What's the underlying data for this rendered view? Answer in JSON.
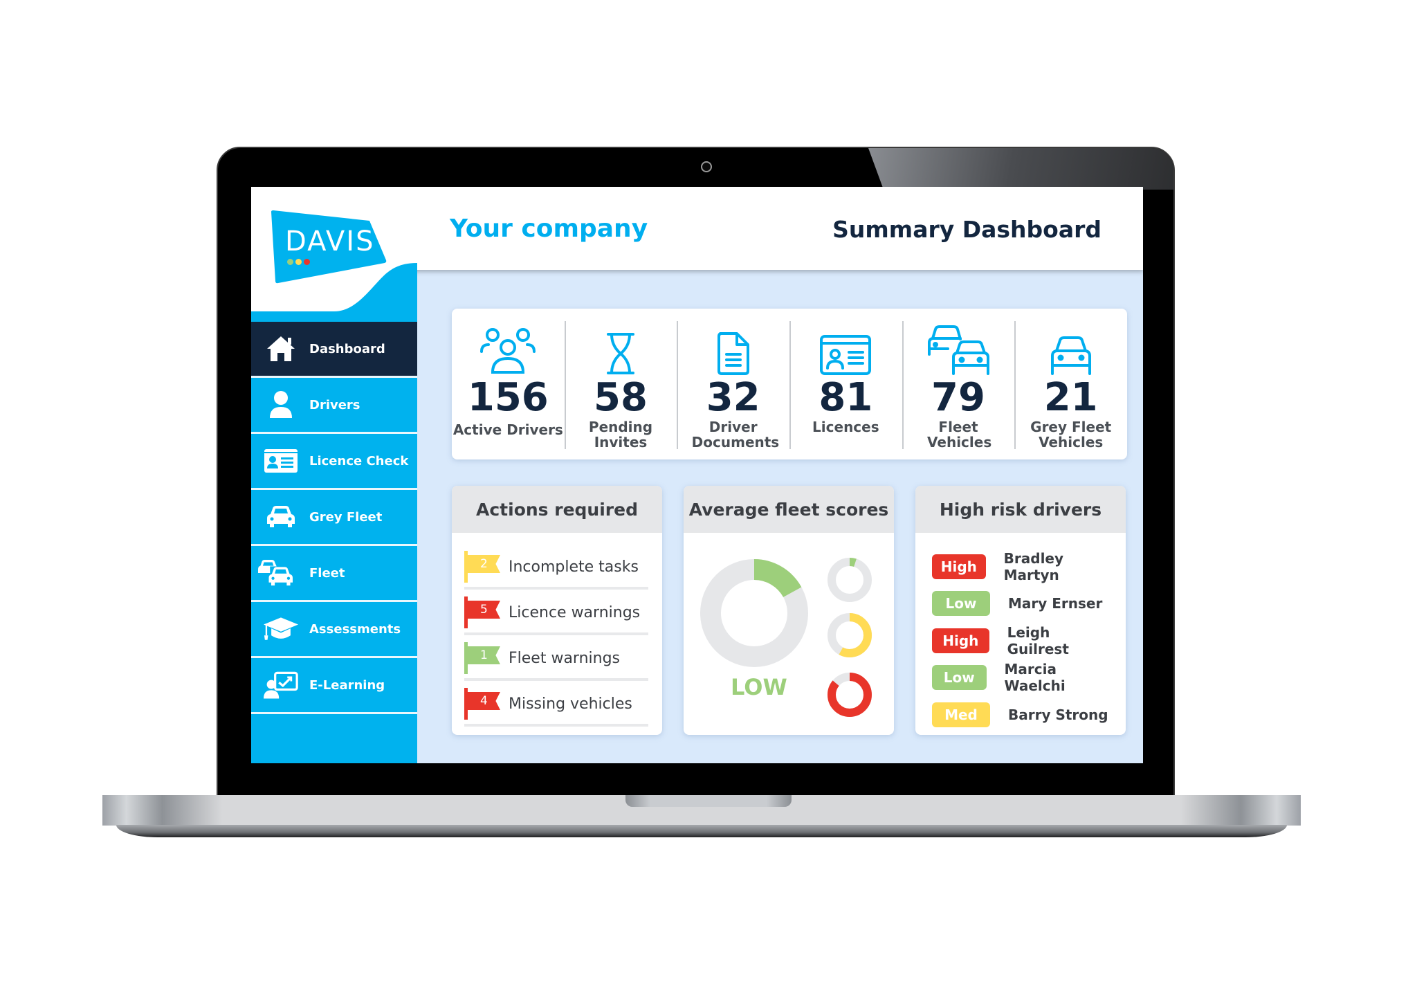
{
  "header": {
    "company_name": "Your company",
    "page_title": "Summary Dashboard"
  },
  "brand": {
    "logo_text": "DAVIS",
    "logo_dots": [
      "#9dcf7b",
      "#ffdb55",
      "#e8352a"
    ],
    "accent_color": "#00b2ee",
    "navy_color": "#13263f"
  },
  "sidebar": {
    "items": [
      {
        "label": "Dashboard",
        "icon": "home-icon",
        "active": true
      },
      {
        "label": "Drivers",
        "icon": "user-icon",
        "active": false
      },
      {
        "label": "Licence Check",
        "icon": "id-card-icon",
        "active": false
      },
      {
        "label": "Grey Fleet",
        "icon": "car-icon",
        "active": false
      },
      {
        "label": "Fleet",
        "icon": "cars-icon",
        "active": false
      },
      {
        "label": "Assessments",
        "icon": "graduation-cap-icon",
        "active": false
      },
      {
        "label": "E-Learning",
        "icon": "presentation-icon",
        "active": false
      }
    ]
  },
  "stats": [
    {
      "value": "156",
      "label": "Active Drivers",
      "icon": "users-icon"
    },
    {
      "value": "58",
      "label": "Pending Invites",
      "icon": "hourglass-icon"
    },
    {
      "value": "32",
      "label": "Driver Documents",
      "icon": "document-icon"
    },
    {
      "value": "81",
      "label": "Licences",
      "icon": "id-card-icon"
    },
    {
      "value": "79",
      "label": "Fleet Vehicles",
      "icon": "cars-icon"
    },
    {
      "value": "21",
      "label": "Grey Fleet Vehicles",
      "icon": "car-icon"
    }
  ],
  "actions": {
    "title": "Actions required",
    "items": [
      {
        "count": "2",
        "label": "Incomplete tasks",
        "color": "#ffdb55"
      },
      {
        "count": "5",
        "label": "Licence warnings",
        "color": "#e8352a"
      },
      {
        "count": "1",
        "label": "Fleet warnings",
        "color": "#9dcf7b"
      },
      {
        "count": "4",
        "label": "Missing vehicles",
        "color": "#e8352a"
      }
    ]
  },
  "scores": {
    "title": "Average fleet scores",
    "overall_label": "LOW",
    "overall": {
      "fraction": 0.17,
      "color": "#9dcf7b"
    },
    "small": [
      {
        "fraction": 0.05,
        "color": "#9dcf7b"
      },
      {
        "fraction": 0.58,
        "color": "#ffdb55"
      },
      {
        "fraction": 0.86,
        "color": "#e8352a"
      }
    ],
    "track_color": "#e6e7e9"
  },
  "risk": {
    "title": "High risk drivers",
    "drivers": [
      {
        "level": "High",
        "name": "Bradley Martyn",
        "color": "#e8352a"
      },
      {
        "level": "Low",
        "name": "Mary Ernser",
        "color": "#9dcf7b"
      },
      {
        "level": "High",
        "name": "Leigh Guilrest",
        "color": "#e8352a"
      },
      {
        "level": "Low",
        "name": "Marcia Waelchi",
        "color": "#9dcf7b"
      },
      {
        "level": "Med",
        "name": "Barry Strong",
        "color": "#ffdb55"
      }
    ]
  }
}
